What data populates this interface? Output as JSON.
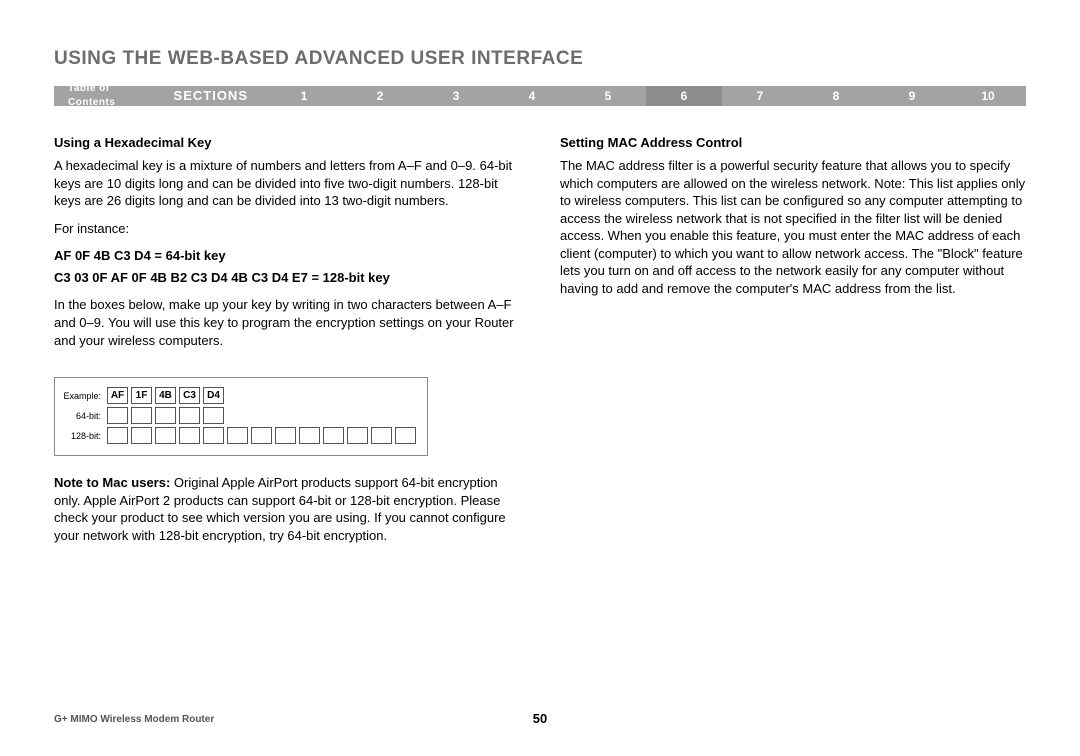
{
  "title": "USING THE WEB-BASED ADVANCED USER INTERFACE",
  "nav": {
    "toc": "Table of Contents",
    "sections_label": "SECTIONS",
    "items": [
      "1",
      "2",
      "3",
      "4",
      "5",
      "6",
      "7",
      "8",
      "9",
      "10"
    ],
    "active_index": 5
  },
  "left": {
    "heading": "Using a Hexadecimal Key",
    "p1": "A hexadecimal key is a mixture of numbers and letters from A–F and 0–9. 64-bit keys are 10 digits long and can be divided into five two-digit numbers. 128-bit keys are 26 digits long and can be divided into 13 two-digit numbers.",
    "p2": "For instance:",
    "key64": "AF 0F 4B C3 D4 = 64-bit key",
    "key128": "C3 03 0F AF 0F 4B B2 C3 D4 4B C3 D4 E7 = 128-bit key",
    "p3": "In the boxes below, make up your key by writing in two characters between A–F and 0–9. You will use this key to program the encryption settings on your Router and your wireless computers.",
    "table": {
      "row_labels": [
        "Example:",
        "64-bit:",
        "128-bit:"
      ],
      "example_values": [
        "AF",
        "1F",
        "4B",
        "C3",
        "D4"
      ],
      "row64_count": 5,
      "row128_count": 13
    },
    "note_label": "Note to Mac users:",
    "note_body": " Original Apple AirPort products support 64-bit encryption only. Apple AirPort 2 products can support 64-bit or 128-bit encryption. Please check your product to see which version you are using. If you cannot configure your network with 128-bit encryption, try 64-bit encryption."
  },
  "right": {
    "heading": "Setting MAC Address Control",
    "p1": "The MAC address filter is a powerful security feature that allows you to specify which computers are allowed on the wireless network. Note: This list applies only to wireless computers. This list can be configured so any computer attempting to access the wireless network that is not specified in the filter list will be denied access. When you enable this feature, you must enter the MAC address of each client (computer) to which you want to allow network access. The \"Block\" feature lets you turn on and off access to the network easily for any computer without having to add and remove the computer's MAC address from the list."
  },
  "footer": {
    "product": "G+ MIMO Wireless Modem Router",
    "page": "50"
  }
}
